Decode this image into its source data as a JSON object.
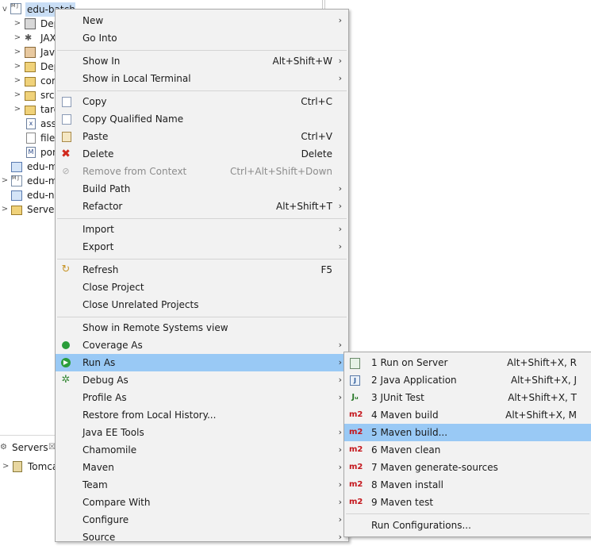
{
  "tree": {
    "root_label": "edu-batch",
    "items": [
      "Dep",
      "JAX",
      "Java",
      "Dep",
      "cor",
      "src",
      "targ",
      "asse",
      "file",
      "pon",
      "edu-m",
      "edu-m",
      "edu-ne",
      "Server"
    ]
  },
  "servers_view": {
    "tab_label": "Servers",
    "tab_close": "☒",
    "item_label": "Tomca"
  },
  "menu": {
    "items": [
      {
        "label": "New",
        "shortcut": "",
        "arrow": "›"
      },
      {
        "label": "Go Into",
        "shortcut": "",
        "arrow": ""
      },
      {
        "label": "Show In",
        "shortcut": "Alt+Shift+W",
        "arrow": "›"
      },
      {
        "label": "Show in Local Terminal",
        "shortcut": "",
        "arrow": "›"
      },
      {
        "label": "Copy",
        "shortcut": "Ctrl+C",
        "arrow": ""
      },
      {
        "label": "Copy Qualified Name",
        "shortcut": "",
        "arrow": ""
      },
      {
        "label": "Paste",
        "shortcut": "Ctrl+V",
        "arrow": ""
      },
      {
        "label": "Delete",
        "shortcut": "Delete",
        "arrow": ""
      },
      {
        "label": "Remove from Context",
        "shortcut": "Ctrl+Alt+Shift+Down",
        "arrow": ""
      },
      {
        "label": "Build Path",
        "shortcut": "",
        "arrow": "›"
      },
      {
        "label": "Refactor",
        "shortcut": "Alt+Shift+T",
        "arrow": "›"
      },
      {
        "label": "Import",
        "shortcut": "",
        "arrow": "›"
      },
      {
        "label": "Export",
        "shortcut": "",
        "arrow": "›"
      },
      {
        "label": "Refresh",
        "shortcut": "F5",
        "arrow": ""
      },
      {
        "label": "Close Project",
        "shortcut": "",
        "arrow": ""
      },
      {
        "label": "Close Unrelated Projects",
        "shortcut": "",
        "arrow": ""
      },
      {
        "label": "Show in Remote Systems view",
        "shortcut": "",
        "arrow": ""
      },
      {
        "label": "Coverage As",
        "shortcut": "",
        "arrow": "›"
      },
      {
        "label": "Run As",
        "shortcut": "",
        "arrow": "›"
      },
      {
        "label": "Debug As",
        "shortcut": "",
        "arrow": "›"
      },
      {
        "label": "Profile As",
        "shortcut": "",
        "arrow": "›"
      },
      {
        "label": "Restore from Local History...",
        "shortcut": "",
        "arrow": ""
      },
      {
        "label": "Java EE Tools",
        "shortcut": "",
        "arrow": "›"
      },
      {
        "label": "Chamomile",
        "shortcut": "",
        "arrow": "›"
      },
      {
        "label": "Maven",
        "shortcut": "",
        "arrow": "›"
      },
      {
        "label": "Team",
        "shortcut": "",
        "arrow": "›"
      },
      {
        "label": "Compare With",
        "shortcut": "",
        "arrow": "›"
      },
      {
        "label": "Configure",
        "shortcut": "",
        "arrow": "›"
      },
      {
        "label": "Source",
        "shortcut": "",
        "arrow": "›"
      }
    ]
  },
  "submenu": {
    "items": [
      {
        "icon": "",
        "label": "1 Run on Server",
        "shortcut": "Alt+Shift+X, R"
      },
      {
        "icon": "",
        "label": "2 Java Application",
        "shortcut": "Alt+Shift+X, J"
      },
      {
        "icon": "Jᵤ",
        "label": "3 JUnit Test",
        "shortcut": "Alt+Shift+X, T"
      },
      {
        "icon": "m2",
        "label": "4 Maven build",
        "shortcut": "Alt+Shift+X, M"
      },
      {
        "icon": "m2",
        "label": "5 Maven build...",
        "shortcut": ""
      },
      {
        "icon": "m2",
        "label": "6 Maven clean",
        "shortcut": ""
      },
      {
        "icon": "m2",
        "label": "7 Maven generate-sources",
        "shortcut": ""
      },
      {
        "icon": "m2",
        "label": "8 Maven install",
        "shortcut": ""
      },
      {
        "icon": "m2",
        "label": "9 Maven test",
        "shortcut": ""
      },
      {
        "icon": "",
        "label": "Run Configurations...",
        "shortcut": ""
      }
    ]
  }
}
